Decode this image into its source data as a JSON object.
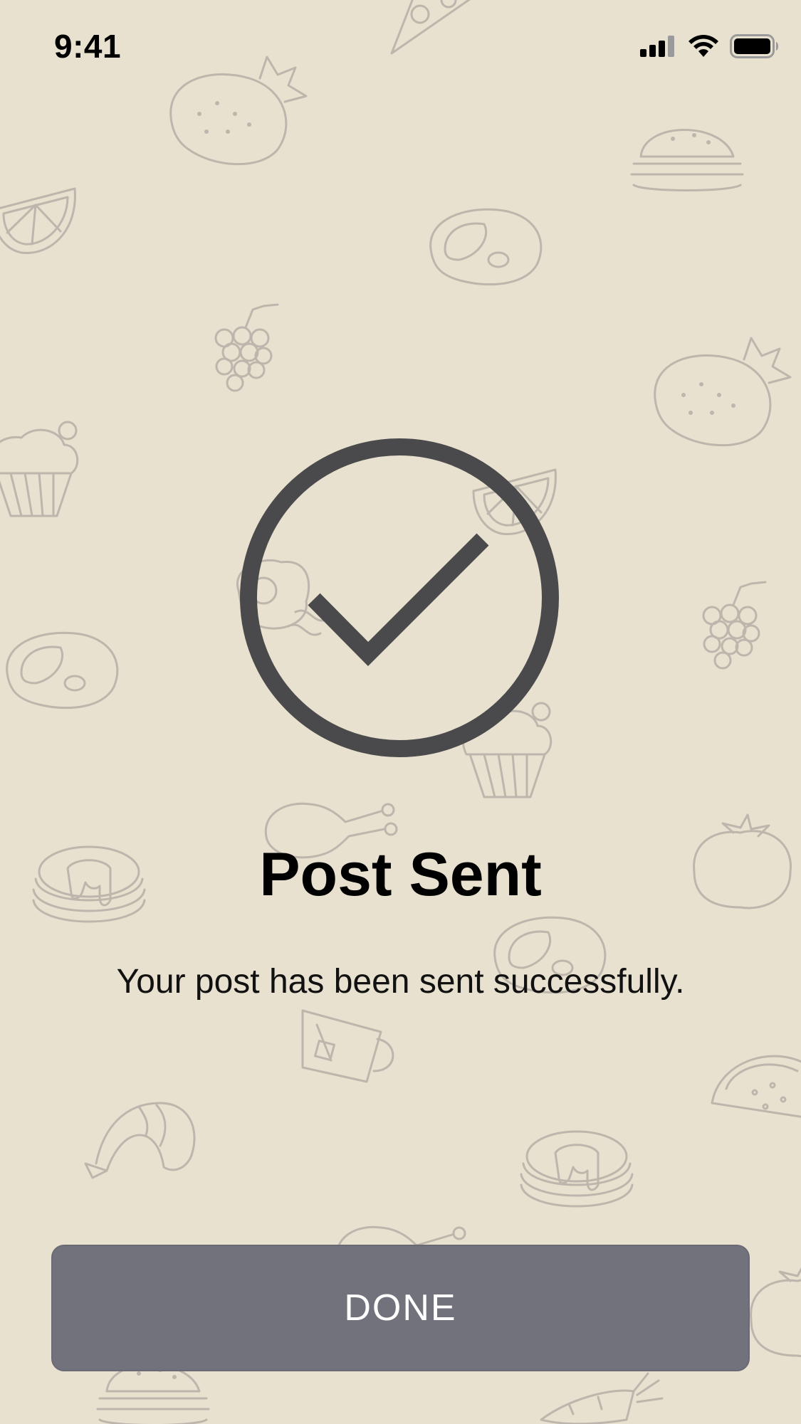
{
  "status_bar": {
    "time": "9:41",
    "icons": [
      "cellular-signal-icon",
      "wifi-icon",
      "battery-icon"
    ]
  },
  "background": {
    "pattern": "food-doodle-pattern",
    "color": "#e8e1cf",
    "doodle_color": "#bcb6ac",
    "doodles": [
      "strawberry-icon",
      "pizza-icon",
      "burger-icon",
      "orange-slice-icon",
      "steak-icon",
      "grapes-icon",
      "cupcake-icon",
      "egg-bacon-icon",
      "chicken-leg-icon",
      "pancakes-icon",
      "tomato-icon",
      "mug-icon",
      "shrimp-icon",
      "taco-icon",
      "carrot-icon"
    ]
  },
  "confirmation": {
    "icon": "check-circle-icon",
    "icon_color": "#4a4a4c",
    "title": "Post Sent",
    "message": "Your post has been sent successfully."
  },
  "actions": {
    "done_label": "DONE",
    "done_color": "#72727c"
  }
}
